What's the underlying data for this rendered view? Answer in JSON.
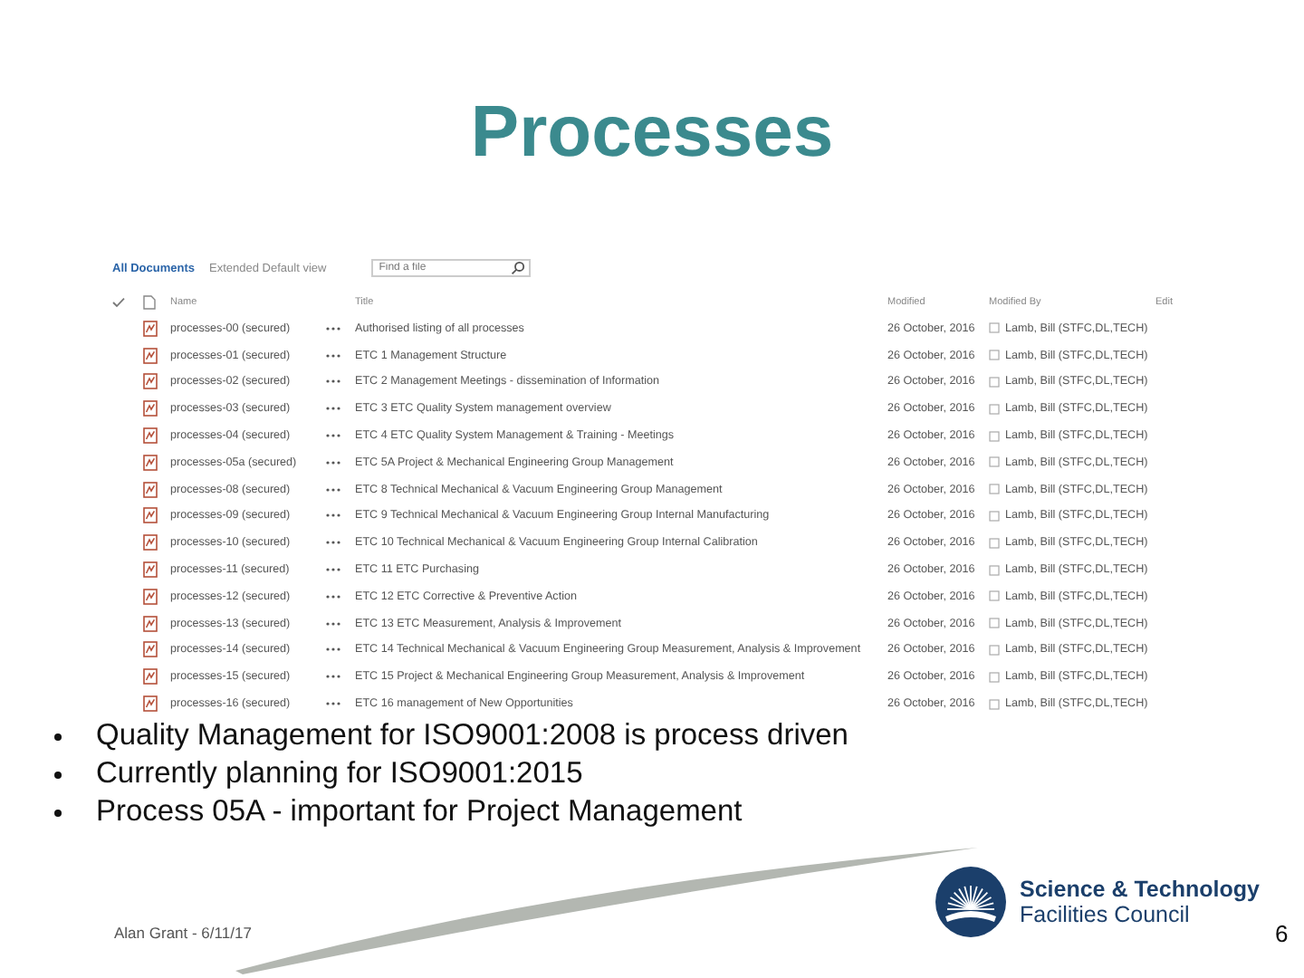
{
  "slide_title": "Processes",
  "library": {
    "view_tabs": [
      {
        "label": "All Documents",
        "selected": true
      },
      {
        "label": "Extended Default view",
        "selected": false
      }
    ],
    "search": {
      "placeholder": "Find a file"
    },
    "columns": [
      "Name",
      "Title",
      "Modified",
      "Modified By",
      "Edit"
    ],
    "rows": [
      {
        "name": "processes-00 (secured)",
        "title": "Authorised listing of all processes",
        "modified": "26 October, 2016",
        "modified_by": "Lamb, Bill (STFC,DL,TECH)"
      },
      {
        "name": "processes-01 (secured)",
        "title": "ETC 1 Management Structure",
        "modified": "26 October, 2016",
        "modified_by": "Lamb, Bill (STFC,DL,TECH)"
      },
      {
        "name": "processes-02 (secured)",
        "title": "ETC 2 Management Meetings - dissemination of Information",
        "modified": "26 October, 2016",
        "modified_by": "Lamb, Bill (STFC,DL,TECH)"
      },
      {
        "name": "processes-03 (secured)",
        "title": "ETC 3 ETC Quality System management overview",
        "modified": "26 October, 2016",
        "modified_by": "Lamb, Bill (STFC,DL,TECH)"
      },
      {
        "name": "processes-04 (secured)",
        "title": "ETC 4 ETC Quality System Management & Training - Meetings",
        "modified": "26 October, 2016",
        "modified_by": "Lamb, Bill (STFC,DL,TECH)"
      },
      {
        "name": "processes-05a (secured)",
        "title": "ETC 5A Project & Mechanical Engineering Group Management",
        "modified": "26 October, 2016",
        "modified_by": "Lamb, Bill (STFC,DL,TECH)"
      },
      {
        "name": "processes-08 (secured)",
        "title": "ETC 8 Technical Mechanical & Vacuum Engineering Group Management",
        "modified": "26 October, 2016",
        "modified_by": "Lamb, Bill (STFC,DL,TECH)"
      },
      {
        "name": "processes-09 (secured)",
        "title": "ETC 9 Technical Mechanical & Vacuum Engineering Group Internal Manufacturing",
        "modified": "26 October, 2016",
        "modified_by": "Lamb, Bill (STFC,DL,TECH)"
      },
      {
        "name": "processes-10 (secured)",
        "title": "ETC 10 Technical Mechanical & Vacuum Engineering Group Internal Calibration",
        "modified": "26 October, 2016",
        "modified_by": "Lamb, Bill (STFC,DL,TECH)"
      },
      {
        "name": "processes-11 (secured)",
        "title": "ETC 11 ETC Purchasing",
        "modified": "26 October, 2016",
        "modified_by": "Lamb, Bill (STFC,DL,TECH)"
      },
      {
        "name": "processes-12 (secured)",
        "title": "ETC 12 ETC Corrective & Preventive Action",
        "modified": "26 October, 2016",
        "modified_by": "Lamb, Bill (STFC,DL,TECH)"
      },
      {
        "name": "processes-13 (secured)",
        "title": "ETC 13 ETC Measurement, Analysis & Improvement",
        "modified": "26 October, 2016",
        "modified_by": "Lamb, Bill (STFC,DL,TECH)"
      },
      {
        "name": "processes-14 (secured)",
        "title": "ETC 14 Technical Mechanical & Vacuum Engineering Group Measurement, Analysis & Improvement",
        "modified": "26 October, 2016",
        "modified_by": "Lamb, Bill (STFC,DL,TECH)"
      },
      {
        "name": "processes-15 (secured)",
        "title": "ETC 15 Project & Mechanical Engineering Group Measurement, Analysis & Improvement",
        "modified": "26 October, 2016",
        "modified_by": "Lamb, Bill (STFC,DL,TECH)"
      },
      {
        "name": "processes-16 (secured)",
        "title": "ETC 16 management of New Opportunities",
        "modified": "26 October, 2016",
        "modified_by": "Lamb, Bill (STFC,DL,TECH)"
      }
    ]
  },
  "bullets": [
    "Quality Management for ISO9001:2008 is process driven",
    "Currently planning for ISO9001:2015",
    "Process 05A - important for Project Management"
  ],
  "footer": {
    "author_date": "Alan Grant - 6/11/17",
    "logo_line_1": "Science & Technology",
    "logo_line_2": "Facilities Council",
    "page_number": "6"
  }
}
